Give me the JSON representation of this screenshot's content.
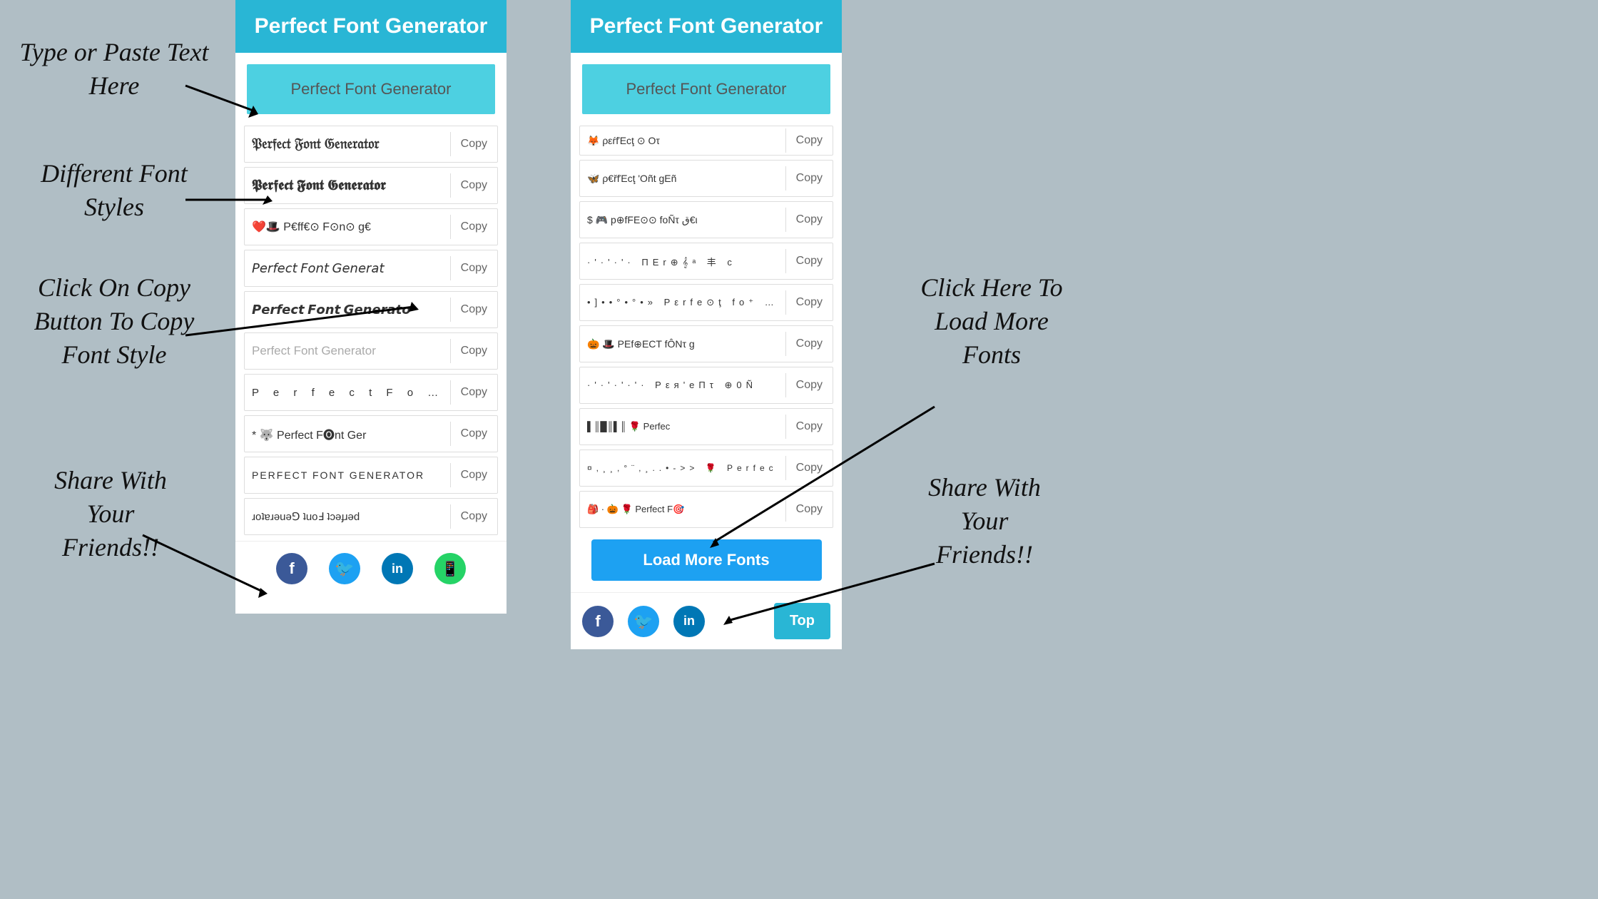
{
  "annotations": {
    "type_paste": "Type or Paste Text\nHere",
    "different_fonts": "Different Font\nStyles",
    "click_copy": "Click On Copy\nButton To Copy\nFont Style",
    "share_left": "Share With\nYour\nFriends!!",
    "click_load": "Click Here To\nLoad More\nFonts",
    "share_right": "Share With\nYour\nFriends!!"
  },
  "header": {
    "title": "Perfect Font Generator"
  },
  "input": {
    "placeholder": "Perfect Font Generator"
  },
  "left_panel": {
    "fonts": [
      {
        "text": "𝔓𝔢𝔯𝔣𝔢𝔠𝔱 𝔉𝔬𝔫𝔱 𝔊𝔢𝔫𝔢𝔯𝔞𝔱𝔬𝔯",
        "copy": "Copy",
        "style": "bold-gothic"
      },
      {
        "text": "𝕻𝖊𝖗𝖋𝖊𝖈𝖙 𝕱𝖔𝖓𝖙 𝕲𝖊𝖓𝖊𝖗𝖆𝖙𝖔𝖗",
        "copy": "Copy",
        "style": "bold-gothic"
      },
      {
        "text": "❤️🎩 P€ff€⊙ F⊙n⊙ g€",
        "copy": "Copy",
        "style": "emoji"
      },
      {
        "text": "𝘗𝘦𝘳𝘧𝘦𝘤𝘵 𝘍𝘰𝘯𝘵 𝘎𝘦𝘯𝘦𝘳𝘢𝘵",
        "copy": "Copy",
        "style": "italic-serif"
      },
      {
        "text": "𝙋𝙚𝙧𝙛𝙚𝙘𝙩 𝙁𝙤𝙣𝙩 𝙂𝙚𝙣𝙚𝙧𝙖𝙩𝙤",
        "copy": "Copy",
        "style": "italic-serif"
      },
      {
        "text": "Perfect Font Generator",
        "copy": "Copy",
        "style": "light"
      },
      {
        "text": "P e r f e c t  F o n t",
        "copy": "Copy",
        "style": "spaced"
      },
      {
        "text": "* 🐺 Perfect F🅞nt Ger",
        "copy": "Copy",
        "style": "emoji"
      },
      {
        "text": "PERFECT FONT GENERATOR",
        "copy": "Copy",
        "style": "upper"
      },
      {
        "text": "ɹoʇɐɹǝuǝ⅁ ʇuoℲ ʇɔǝɟɹǝd",
        "copy": "Copy",
        "style": "reverse"
      }
    ]
  },
  "right_panel": {
    "input": "Perfect Font Generator",
    "fonts": [
      {
        "text": "🦋 ρ€řfΈcţ 'Oñt gEñ",
        "copy": "Copy",
        "style": "emoji"
      },
      {
        "text": "$ 🎮 p⊕fFE⊙⊙ foÑτ ق€ι",
        "copy": "Copy",
        "style": "emoji"
      },
      {
        "text": "·'·'·'· ΠΕr⊕𝄞ᵃ 丰 c",
        "copy": "Copy",
        "style": "dotted"
      },
      {
        "text": "•]••°•°•» Pεrfe⊙ţ fo⁺ ge⊗",
        "copy": "Copy",
        "style": "dotted"
      },
      {
        "text": "🎃 🎩 ΡΕf⊕ΕCT fÔNτ g",
        "copy": "Copy",
        "style": "emoji"
      },
      {
        "text": "·'·'·'·'· Pεя'eΠτ ⊕0Ñ",
        "copy": "Copy",
        "style": "dotted"
      },
      {
        "text": "▌║█║▌║ 🌹 Perfec",
        "copy": "Copy",
        "style": "small-caps"
      },
      {
        "text": "¤,¸¸,•°¨,•¸..•-..>>  🌹 Perfec",
        "copy": "Copy",
        "style": "dotted"
      },
      {
        "text": "🎒 · 🎃 🌹 Perfect F🎯",
        "copy": "Copy",
        "style": "emoji"
      }
    ],
    "partial_top": {
      "text": "🦊 ρ€rfΈcţ⊙ Ot",
      "copy": "Copy"
    }
  },
  "buttons": {
    "load_more": "Load More Fonts",
    "top": "Top",
    "copy": "Copy"
  },
  "social": {
    "fb": "f",
    "twitter": "🐦",
    "linkedin": "in",
    "whatsapp": "W"
  }
}
